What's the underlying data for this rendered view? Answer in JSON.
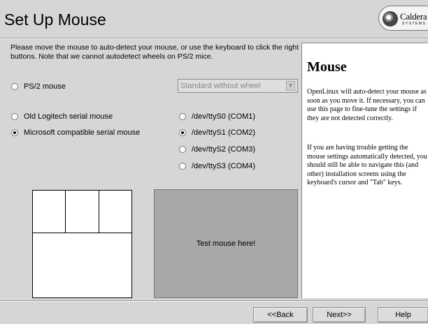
{
  "header": {
    "title": "Set Up Mouse",
    "logo_name": "Caldera",
    "logo_sub": "SYSTEMS"
  },
  "instruction": "Please move the mouse to auto-detect your mouse, or use the keyboard to click the right buttons. Note that we cannot autodetect wheels on PS/2 mice.",
  "mouse_types": {
    "ps2": {
      "label": "PS/2 mouse",
      "selected": false
    },
    "logitech": {
      "label": "Old Logitech serial mouse",
      "selected": false
    },
    "microsoft": {
      "label": "Microsoft compatible serial mouse",
      "selected": true
    }
  },
  "wheel_select": {
    "value": "Standard without wheel",
    "disabled": true
  },
  "ports": [
    {
      "label": "/dev/ttyS0 (COM1)",
      "selected": false
    },
    {
      "label": "/dev/ttyS1 (COM2)",
      "selected": true
    },
    {
      "label": "/dev/ttyS2 (COM3)",
      "selected": false
    },
    {
      "label": "/dev/ttyS3 (COM4)",
      "selected": false
    }
  ],
  "test_area": {
    "label": "Test mouse here!"
  },
  "help": {
    "title": "Mouse",
    "para1": "OpenLinux will auto-detect your mouse as soon as you move it. If necessary, you can use this page to fine-tune the settings if they are not detected correctly.",
    "para2": "If you are having trouble getting the mouse settings automatically detected, you should still be able to navigate this (and other) installation screens using the keyboard's cursor and \"Tab\" keys."
  },
  "buttons": {
    "back": "<<Back",
    "next": "Next>>",
    "help": "Help"
  }
}
